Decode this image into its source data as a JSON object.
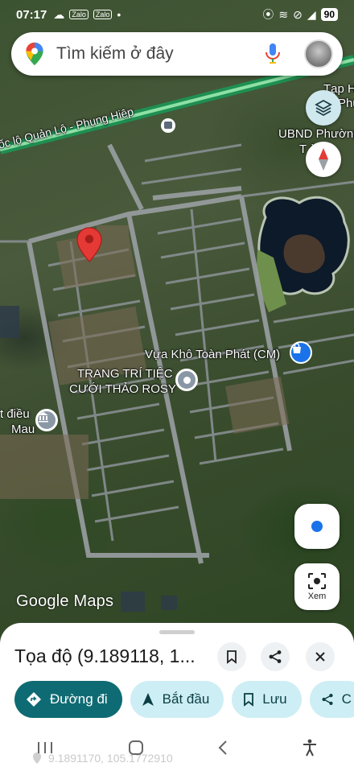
{
  "status_bar": {
    "time": "07:17",
    "app_badges": [
      "Zalo",
      "Zalo"
    ],
    "battery": "90"
  },
  "search": {
    "placeholder": "Tìm kiếm ở đây"
  },
  "map": {
    "labels": {
      "road": "ốc lộ Quản Lộ - Phụng Hiệp",
      "tap_hoa": "Tạp H",
      "tap_hoa_2": "Phư",
      "ubnd": "UBND Phường",
      "ubnd_2": "T        àn",
      "vua_kho": "Vựa Khô Toàn Phát (CM)",
      "trang_tri_1": "TRANG TRÍ TIỆC",
      "trang_tri_2": "CƯỚI THẢO ROSY",
      "left_place_1": "t điều",
      "left_place_2": "Mau"
    },
    "logo_part1": "Google",
    "logo_part2": "Maps"
  },
  "buttons": {
    "view_label": "Xem"
  },
  "sheet": {
    "title": "Tọa độ (9.189118, 1...",
    "chips": [
      {
        "label": "Đường đi",
        "style": "primary"
      },
      {
        "label": "Bắt đầu",
        "style": "secondary"
      },
      {
        "label": "Lưu",
        "style": "secondary"
      },
      {
        "label": "C",
        "style": "secondary"
      }
    ],
    "coordinates": "9.1891170, 105.1772910"
  },
  "colors": {
    "primary": "#0f6b73",
    "chip_secondary": "#cdeef4",
    "marker": "#e53935"
  }
}
